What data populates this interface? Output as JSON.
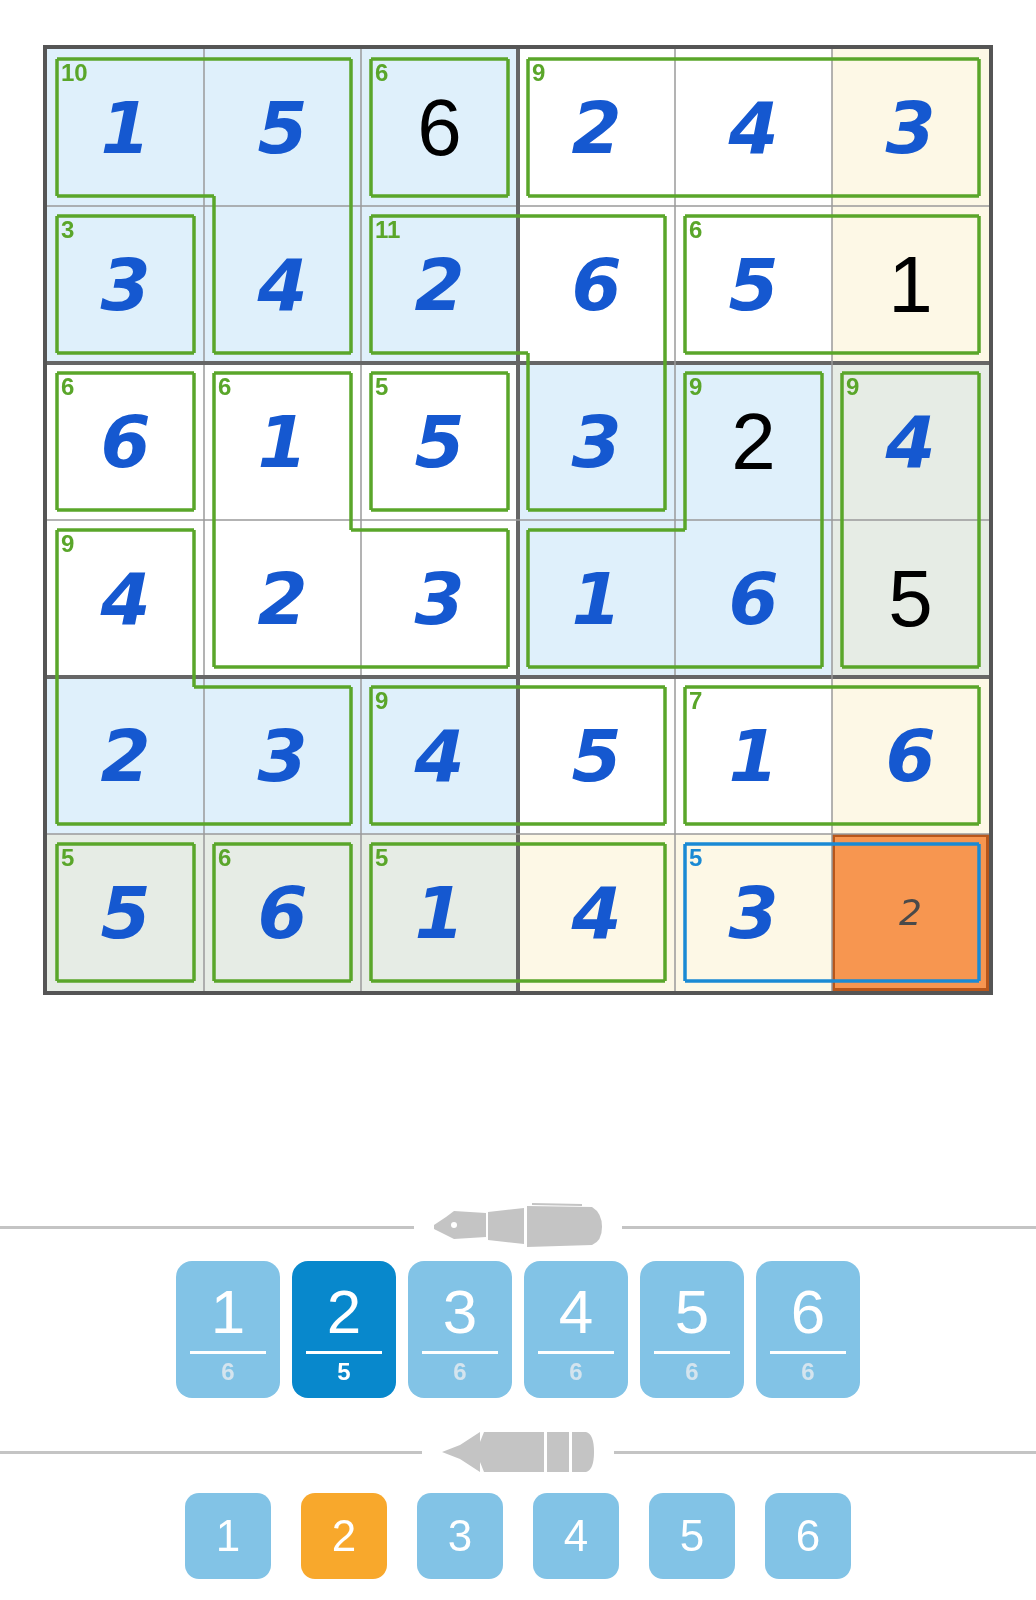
{
  "grid": {
    "rows": [
      [
        {
          "value": "1",
          "kind": "entered",
          "color": "#dff0fb",
          "selected": false,
          "wall_right": false,
          "wall_down": true
        },
        {
          "value": "5",
          "kind": "entered",
          "color": "#dff0fb",
          "selected": false,
          "wall_right": true,
          "wall_down": false
        },
        {
          "value": "6",
          "kind": "given",
          "color": "#dff0fb",
          "selected": false,
          "wall_right": true,
          "wall_down": true
        },
        {
          "value": "2",
          "kind": "entered",
          "color": "#ffffff",
          "selected": false,
          "wall_right": false,
          "wall_down": true
        },
        {
          "value": "4",
          "kind": "entered",
          "color": "#ffffff",
          "selected": false,
          "wall_right": false,
          "wall_down": true
        },
        {
          "value": "3",
          "kind": "entered",
          "color": "#fdf8e6",
          "selected": false,
          "wall_down": true
        }
      ],
      [
        {
          "value": "3",
          "kind": "entered",
          "color": "#dff0fb",
          "selected": false,
          "wall_right": true,
          "wall_down": true
        },
        {
          "value": "4",
          "kind": "entered",
          "color": "#dff0fb",
          "selected": false,
          "wall_right": true,
          "wall_down": true
        },
        {
          "value": "2",
          "kind": "entered",
          "color": "#dff0fb",
          "selected": false,
          "wall_right": false,
          "wall_down": true
        },
        {
          "value": "6",
          "kind": "entered",
          "color": "#ffffff",
          "selected": false,
          "wall_right": true,
          "wall_down": false
        },
        {
          "value": "5",
          "kind": "entered",
          "color": "#ffffff",
          "selected": false,
          "wall_right": false,
          "wall_down": true
        },
        {
          "value": "1",
          "kind": "given",
          "color": "#fdf8e6",
          "selected": false,
          "wall_down": true
        }
      ],
      [
        {
          "value": "6",
          "kind": "entered",
          "color": "#ffffff",
          "selected": false,
          "wall_right": true,
          "wall_down": true
        },
        {
          "value": "1",
          "kind": "entered",
          "color": "#ffffff",
          "selected": false,
          "wall_right": true,
          "wall_down": false
        },
        {
          "value": "5",
          "kind": "entered",
          "color": "#ffffff",
          "selected": false,
          "wall_right": true,
          "wall_down": true
        },
        {
          "value": "3",
          "kind": "entered",
          "color": "#dff0fb",
          "selected": false,
          "wall_right": true,
          "wall_down": true
        },
        {
          "value": "2",
          "kind": "given",
          "color": "#dff0fb",
          "selected": false,
          "wall_right": true,
          "wall_down": false
        },
        {
          "value": "4",
          "kind": "entered",
          "color": "#e6ece5",
          "selected": false,
          "wall_down": false
        }
      ],
      [
        {
          "value": "4",
          "kind": "entered",
          "color": "#ffffff",
          "selected": false,
          "wall_right": true,
          "wall_down": false
        },
        {
          "value": "2",
          "kind": "entered",
          "color": "#ffffff",
          "selected": false,
          "wall_right": false,
          "wall_down": true
        },
        {
          "value": "3",
          "kind": "entered",
          "color": "#ffffff",
          "selected": false,
          "wall_right": true,
          "wall_down": true
        },
        {
          "value": "1",
          "kind": "entered",
          "color": "#dff0fb",
          "selected": false,
          "wall_right": false,
          "wall_down": true
        },
        {
          "value": "6",
          "kind": "entered",
          "color": "#dff0fb",
          "selected": false,
          "wall_right": true,
          "wall_down": true
        },
        {
          "value": "5",
          "kind": "given",
          "color": "#e6ece5",
          "selected": false,
          "wall_down": true
        }
      ],
      [
        {
          "value": "2",
          "kind": "entered",
          "color": "#dff0fb",
          "selected": false,
          "wall_right": false,
          "wall_down": true
        },
        {
          "value": "3",
          "kind": "entered",
          "color": "#dff0fb",
          "selected": false,
          "wall_right": true,
          "wall_down": true
        },
        {
          "value": "4",
          "kind": "entered",
          "color": "#dff0fb",
          "selected": false,
          "wall_right": false,
          "wall_down": true
        },
        {
          "value": "5",
          "kind": "entered",
          "color": "#ffffff",
          "selected": false,
          "wall_right": true,
          "wall_down": true
        },
        {
          "value": "1",
          "kind": "entered",
          "color": "#ffffff",
          "selected": false,
          "wall_right": false,
          "wall_down": true
        },
        {
          "value": "6",
          "kind": "entered",
          "color": "#fdf8e6",
          "selected": false,
          "wall_down": true
        }
      ],
      [
        {
          "value": "5",
          "kind": "entered",
          "color": "#e6ece5",
          "selected": false,
          "wall_right": true
        },
        {
          "value": "6",
          "kind": "entered",
          "color": "#e6ece5",
          "selected": false,
          "wall_right": true
        },
        {
          "value": "1",
          "kind": "entered",
          "color": "#e6ece5",
          "selected": false,
          "wall_right": false
        },
        {
          "value": "4",
          "kind": "entered",
          "color": "#fdf8e6",
          "selected": false,
          "wall_right": true
        },
        {
          "value": "3",
          "kind": "entered",
          "color": "#fdf8e6",
          "selected": false,
          "wall_right": false
        },
        {
          "value": "2",
          "kind": "note",
          "color": "#f79650",
          "selected": true
        }
      ]
    ],
    "cages": [
      {
        "sum": "10",
        "selected": false
      },
      {
        "sum": "6",
        "selected": false
      },
      {
        "sum": "9",
        "selected": false
      },
      {
        "sum": "3",
        "selected": false
      },
      {
        "sum": "11",
        "selected": false
      },
      {
        "sum": "6",
        "selected": false
      },
      {
        "sum": "6",
        "selected": false
      },
      {
        "sum": "6",
        "selected": false
      },
      {
        "sum": "5",
        "selected": false
      },
      {
        "sum": "9",
        "selected": false
      },
      {
        "sum": "9",
        "selected": false
      },
      {
        "sum": "9",
        "selected": false
      },
      {
        "sum": "9",
        "selected": false
      },
      {
        "sum": "7",
        "selected": false
      },
      {
        "sum": "5",
        "selected": false
      },
      {
        "sum": "6",
        "selected": false
      },
      {
        "sum": "5",
        "selected": false
      },
      {
        "sum": "5",
        "selected": true
      }
    ]
  },
  "pen": {
    "buttons": [
      {
        "digit": "1",
        "count": "6",
        "selected": false
      },
      {
        "digit": "2",
        "count": "5",
        "selected": true
      },
      {
        "digit": "3",
        "count": "6",
        "selected": false
      },
      {
        "digit": "4",
        "count": "6",
        "selected": false
      },
      {
        "digit": "5",
        "count": "6",
        "selected": false
      },
      {
        "digit": "6",
        "count": "6",
        "selected": false
      }
    ]
  },
  "pencil": {
    "buttons": [
      {
        "digit": "1",
        "selected": false
      },
      {
        "digit": "2",
        "selected": true
      },
      {
        "digit": "3",
        "selected": false
      },
      {
        "digit": "4",
        "selected": false
      },
      {
        "digit": "5",
        "selected": false
      },
      {
        "digit": "6",
        "selected": false
      }
    ]
  }
}
